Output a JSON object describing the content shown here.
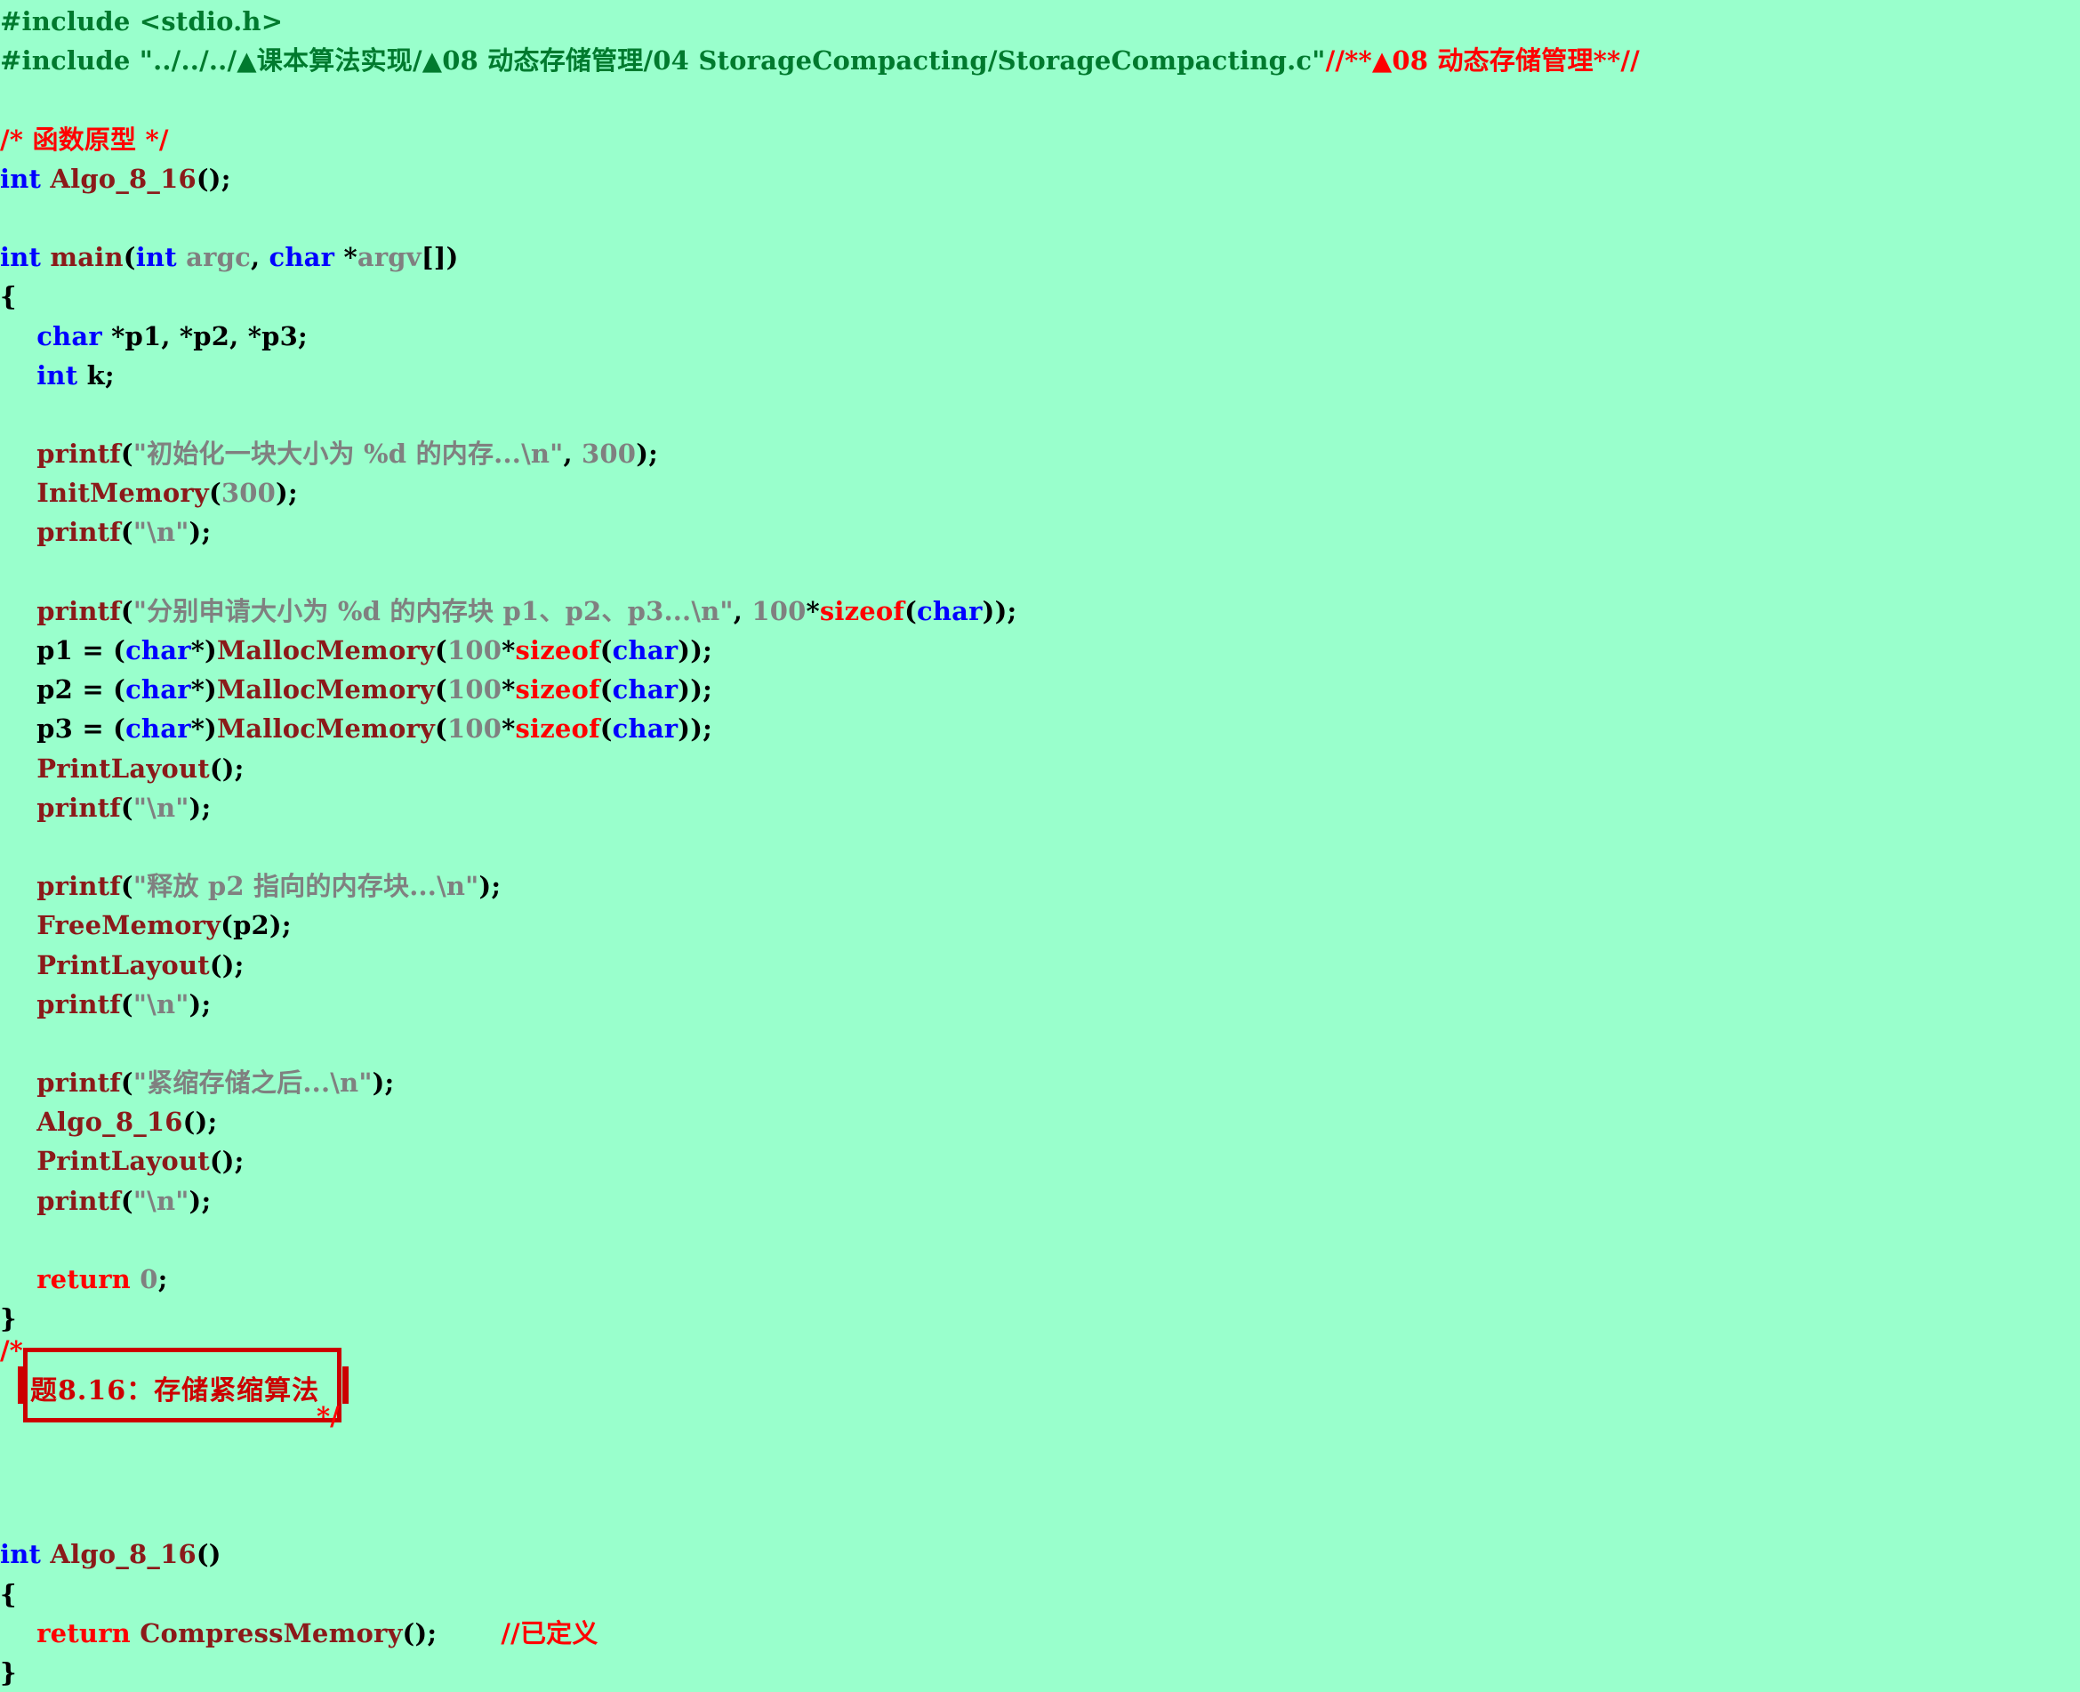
{
  "editor": {
    "background_color": "#99FFCC",
    "language": "C",
    "file_name": "StorageCompacting.c"
  },
  "colors": {
    "preprocessor": "#007A2E",
    "comment": "#FF0000",
    "type_keyword": "#0000FF",
    "control_keyword": "#FF0000",
    "function_name": "#8B1A1A",
    "string_literal": "#808080",
    "number_literal": "#808080",
    "parameter": "#808080",
    "plain": "#000000",
    "banner_border": "#CC0000"
  },
  "code_lines": [
    {
      "n": 1,
      "tokens": [
        {
          "t": "#include <stdio.h>",
          "c": "tok-pre"
        }
      ]
    },
    {
      "n": 2,
      "tokens": [
        {
          "t": "#include \"../../../▲课本算法实现/▲08 动态存储管理/04 StorageCompacting/StorageCompacting.c\"",
          "c": "tok-pre"
        },
        {
          "t": "//**▲08 动态存储管理**//",
          "c": "tok-cmt"
        }
      ]
    },
    {
      "n": 3,
      "tokens": [
        {
          "t": "",
          "c": "tok-plain"
        }
      ]
    },
    {
      "n": 4,
      "tokens": [
        {
          "t": "/* 函数原型 */",
          "c": "tok-cmt"
        }
      ]
    },
    {
      "n": 5,
      "tokens": [
        {
          "t": "int",
          "c": "tok-kw"
        },
        {
          "t": " ",
          "c": "tok-plain"
        },
        {
          "t": "Algo_8_16",
          "c": "tok-fn"
        },
        {
          "t": "();",
          "c": "tok-plain"
        }
      ]
    },
    {
      "n": 6,
      "tokens": [
        {
          "t": "",
          "c": "tok-plain"
        }
      ]
    },
    {
      "n": 7,
      "tokens": [
        {
          "t": "int",
          "c": "tok-kw"
        },
        {
          "t": " ",
          "c": "tok-plain"
        },
        {
          "t": "main",
          "c": "tok-fn"
        },
        {
          "t": "(",
          "c": "tok-plain"
        },
        {
          "t": "int",
          "c": "tok-kw"
        },
        {
          "t": " ",
          "c": "tok-plain"
        },
        {
          "t": "argc",
          "c": "tok-param"
        },
        {
          "t": ", ",
          "c": "tok-plain"
        },
        {
          "t": "char",
          "c": "tok-kw"
        },
        {
          "t": " *",
          "c": "tok-plain"
        },
        {
          "t": "argv",
          "c": "tok-param"
        },
        {
          "t": "[])",
          "c": "tok-plain"
        }
      ]
    },
    {
      "n": 8,
      "tokens": [
        {
          "t": "{",
          "c": "tok-plain"
        }
      ]
    },
    {
      "n": 9,
      "tokens": [
        {
          "t": "    ",
          "c": "tok-plain"
        },
        {
          "t": "char",
          "c": "tok-kw"
        },
        {
          "t": " *p1, *p2, *p3;",
          "c": "tok-plain"
        }
      ]
    },
    {
      "n": 10,
      "tokens": [
        {
          "t": "    ",
          "c": "tok-plain"
        },
        {
          "t": "int",
          "c": "tok-kw"
        },
        {
          "t": " k;",
          "c": "tok-plain"
        }
      ]
    },
    {
      "n": 11,
      "tokens": [
        {
          "t": "",
          "c": "tok-plain"
        }
      ]
    },
    {
      "n": 12,
      "tokens": [
        {
          "t": "    ",
          "c": "tok-plain"
        },
        {
          "t": "printf",
          "c": "tok-fn"
        },
        {
          "t": "(",
          "c": "tok-plain"
        },
        {
          "t": "\"初始化一块大小为 %d 的内存...\\n\"",
          "c": "tok-str"
        },
        {
          "t": ", ",
          "c": "tok-plain"
        },
        {
          "t": "300",
          "c": "tok-num"
        },
        {
          "t": ");",
          "c": "tok-plain"
        }
      ]
    },
    {
      "n": 13,
      "tokens": [
        {
          "t": "    ",
          "c": "tok-plain"
        },
        {
          "t": "InitMemory",
          "c": "tok-fn"
        },
        {
          "t": "(",
          "c": "tok-plain"
        },
        {
          "t": "300",
          "c": "tok-num"
        },
        {
          "t": ");",
          "c": "tok-plain"
        }
      ]
    },
    {
      "n": 14,
      "tokens": [
        {
          "t": "    ",
          "c": "tok-plain"
        },
        {
          "t": "printf",
          "c": "tok-fn"
        },
        {
          "t": "(",
          "c": "tok-plain"
        },
        {
          "t": "\"\\n\"",
          "c": "tok-str"
        },
        {
          "t": ");",
          "c": "tok-plain"
        }
      ]
    },
    {
      "n": 15,
      "tokens": [
        {
          "t": "",
          "c": "tok-plain"
        }
      ]
    },
    {
      "n": 16,
      "tokens": [
        {
          "t": "    ",
          "c": "tok-plain"
        },
        {
          "t": "printf",
          "c": "tok-fn"
        },
        {
          "t": "(",
          "c": "tok-plain"
        },
        {
          "t": "\"分别申请大小为 %d 的内存块 p1、p2、p3...\\n\"",
          "c": "tok-str"
        },
        {
          "t": ", ",
          "c": "tok-plain"
        },
        {
          "t": "100",
          "c": "tok-num"
        },
        {
          "t": "*",
          "c": "tok-plain"
        },
        {
          "t": "sizeof",
          "c": "tok-ctl"
        },
        {
          "t": "(",
          "c": "tok-plain"
        },
        {
          "t": "char",
          "c": "tok-kw"
        },
        {
          "t": "));",
          "c": "tok-plain"
        }
      ]
    },
    {
      "n": 17,
      "tokens": [
        {
          "t": "    p1 = (",
          "c": "tok-plain"
        },
        {
          "t": "char",
          "c": "tok-kw"
        },
        {
          "t": "*)",
          "c": "tok-plain"
        },
        {
          "t": "MallocMemory",
          "c": "tok-fn"
        },
        {
          "t": "(",
          "c": "tok-plain"
        },
        {
          "t": "100",
          "c": "tok-num"
        },
        {
          "t": "*",
          "c": "tok-plain"
        },
        {
          "t": "sizeof",
          "c": "tok-ctl"
        },
        {
          "t": "(",
          "c": "tok-plain"
        },
        {
          "t": "char",
          "c": "tok-kw"
        },
        {
          "t": "));",
          "c": "tok-plain"
        }
      ]
    },
    {
      "n": 18,
      "tokens": [
        {
          "t": "    p2 = (",
          "c": "tok-plain"
        },
        {
          "t": "char",
          "c": "tok-kw"
        },
        {
          "t": "*)",
          "c": "tok-plain"
        },
        {
          "t": "MallocMemory",
          "c": "tok-fn"
        },
        {
          "t": "(",
          "c": "tok-plain"
        },
        {
          "t": "100",
          "c": "tok-num"
        },
        {
          "t": "*",
          "c": "tok-plain"
        },
        {
          "t": "sizeof",
          "c": "tok-ctl"
        },
        {
          "t": "(",
          "c": "tok-plain"
        },
        {
          "t": "char",
          "c": "tok-kw"
        },
        {
          "t": "));",
          "c": "tok-plain"
        }
      ]
    },
    {
      "n": 19,
      "tokens": [
        {
          "t": "    p3 = (",
          "c": "tok-plain"
        },
        {
          "t": "char",
          "c": "tok-kw"
        },
        {
          "t": "*)",
          "c": "tok-plain"
        },
        {
          "t": "MallocMemory",
          "c": "tok-fn"
        },
        {
          "t": "(",
          "c": "tok-plain"
        },
        {
          "t": "100",
          "c": "tok-num"
        },
        {
          "t": "*",
          "c": "tok-plain"
        },
        {
          "t": "sizeof",
          "c": "tok-ctl"
        },
        {
          "t": "(",
          "c": "tok-plain"
        },
        {
          "t": "char",
          "c": "tok-kw"
        },
        {
          "t": "));",
          "c": "tok-plain"
        }
      ]
    },
    {
      "n": 20,
      "tokens": [
        {
          "t": "    ",
          "c": "tok-plain"
        },
        {
          "t": "PrintLayout",
          "c": "tok-fn"
        },
        {
          "t": "();",
          "c": "tok-plain"
        }
      ]
    },
    {
      "n": 21,
      "tokens": [
        {
          "t": "    ",
          "c": "tok-plain"
        },
        {
          "t": "printf",
          "c": "tok-fn"
        },
        {
          "t": "(",
          "c": "tok-plain"
        },
        {
          "t": "\"\\n\"",
          "c": "tok-str"
        },
        {
          "t": ");",
          "c": "tok-plain"
        }
      ]
    },
    {
      "n": 22,
      "tokens": [
        {
          "t": "",
          "c": "tok-plain"
        }
      ]
    },
    {
      "n": 23,
      "tokens": [
        {
          "t": "    ",
          "c": "tok-plain"
        },
        {
          "t": "printf",
          "c": "tok-fn"
        },
        {
          "t": "(",
          "c": "tok-plain"
        },
        {
          "t": "\"释放 p2 指向的内存块...\\n\"",
          "c": "tok-str"
        },
        {
          "t": ");",
          "c": "tok-plain"
        }
      ]
    },
    {
      "n": 24,
      "tokens": [
        {
          "t": "    ",
          "c": "tok-plain"
        },
        {
          "t": "FreeMemory",
          "c": "tok-fn"
        },
        {
          "t": "(p2);",
          "c": "tok-plain"
        }
      ]
    },
    {
      "n": 25,
      "tokens": [
        {
          "t": "    ",
          "c": "tok-plain"
        },
        {
          "t": "PrintLayout",
          "c": "tok-fn"
        },
        {
          "t": "();",
          "c": "tok-plain"
        }
      ]
    },
    {
      "n": 26,
      "tokens": [
        {
          "t": "    ",
          "c": "tok-plain"
        },
        {
          "t": "printf",
          "c": "tok-fn"
        },
        {
          "t": "(",
          "c": "tok-plain"
        },
        {
          "t": "\"\\n\"",
          "c": "tok-str"
        },
        {
          "t": ");",
          "c": "tok-plain"
        }
      ]
    },
    {
      "n": 27,
      "tokens": [
        {
          "t": "",
          "c": "tok-plain"
        }
      ]
    },
    {
      "n": 28,
      "tokens": [
        {
          "t": "    ",
          "c": "tok-plain"
        },
        {
          "t": "printf",
          "c": "tok-fn"
        },
        {
          "t": "(",
          "c": "tok-plain"
        },
        {
          "t": "\"紧缩存储之后...\\n\"",
          "c": "tok-str"
        },
        {
          "t": ");",
          "c": "tok-plain"
        }
      ]
    },
    {
      "n": 29,
      "tokens": [
        {
          "t": "    ",
          "c": "tok-plain"
        },
        {
          "t": "Algo_8_16",
          "c": "tok-fn"
        },
        {
          "t": "();",
          "c": "tok-plain"
        }
      ]
    },
    {
      "n": 30,
      "tokens": [
        {
          "t": "    ",
          "c": "tok-plain"
        },
        {
          "t": "PrintLayout",
          "c": "tok-fn"
        },
        {
          "t": "();",
          "c": "tok-plain"
        }
      ]
    },
    {
      "n": 31,
      "tokens": [
        {
          "t": "    ",
          "c": "tok-plain"
        },
        {
          "t": "printf",
          "c": "tok-fn"
        },
        {
          "t": "(",
          "c": "tok-plain"
        },
        {
          "t": "\"\\n\"",
          "c": "tok-str"
        },
        {
          "t": ");",
          "c": "tok-plain"
        }
      ]
    },
    {
      "n": 32,
      "tokens": [
        {
          "t": "",
          "c": "tok-plain"
        }
      ]
    },
    {
      "n": 33,
      "tokens": [
        {
          "t": "    ",
          "c": "tok-plain"
        },
        {
          "t": "return",
          "c": "tok-ctl"
        },
        {
          "t": " ",
          "c": "tok-plain"
        },
        {
          "t": "0",
          "c": "tok-num"
        },
        {
          "t": ";",
          "c": "tok-plain"
        }
      ]
    },
    {
      "n": 34,
      "tokens": [
        {
          "t": "}",
          "c": "tok-plain"
        }
      ]
    },
    {
      "n": 35,
      "tokens": [
        {
          "t": "",
          "c": "tok-plain"
        }
      ]
    },
    {
      "n": 36,
      "tokens": [
        {
          "t": "",
          "c": "tok-plain"
        }
      ]
    },
    {
      "n": 37,
      "tokens": [
        {
          "t": "",
          "c": "tok-plain"
        }
      ]
    },
    {
      "n": 38,
      "tokens": [
        {
          "t": "",
          "c": "tok-plain"
        }
      ]
    },
    {
      "n": 39,
      "tokens": [
        {
          "t": "",
          "c": "tok-plain"
        }
      ]
    },
    {
      "n": 40,
      "tokens": [
        {
          "t": "int",
          "c": "tok-kw"
        },
        {
          "t": " ",
          "c": "tok-plain"
        },
        {
          "t": "Algo_8_16",
          "c": "tok-fn"
        },
        {
          "t": "()",
          "c": "tok-plain"
        }
      ]
    },
    {
      "n": 41,
      "tokens": [
        {
          "t": "{",
          "c": "tok-plain"
        }
      ]
    },
    {
      "n": 42,
      "tokens": [
        {
          "t": "    ",
          "c": "tok-plain"
        },
        {
          "t": "return",
          "c": "tok-ctl"
        },
        {
          "t": " ",
          "c": "tok-plain"
        },
        {
          "t": "CompressMemory",
          "c": "tok-fn"
        },
        {
          "t": "();    ",
          "c": "tok-plain"
        },
        {
          "t": "   //已定义",
          "c": "tok-cmt"
        }
      ]
    },
    {
      "n": 43,
      "tokens": [
        {
          "t": "}",
          "c": "tok-plain"
        }
      ]
    }
  ],
  "banner_comment": {
    "open_marker": "/*",
    "close_marker": "*/",
    "title": "题8.16：存储紧缩算法"
  }
}
